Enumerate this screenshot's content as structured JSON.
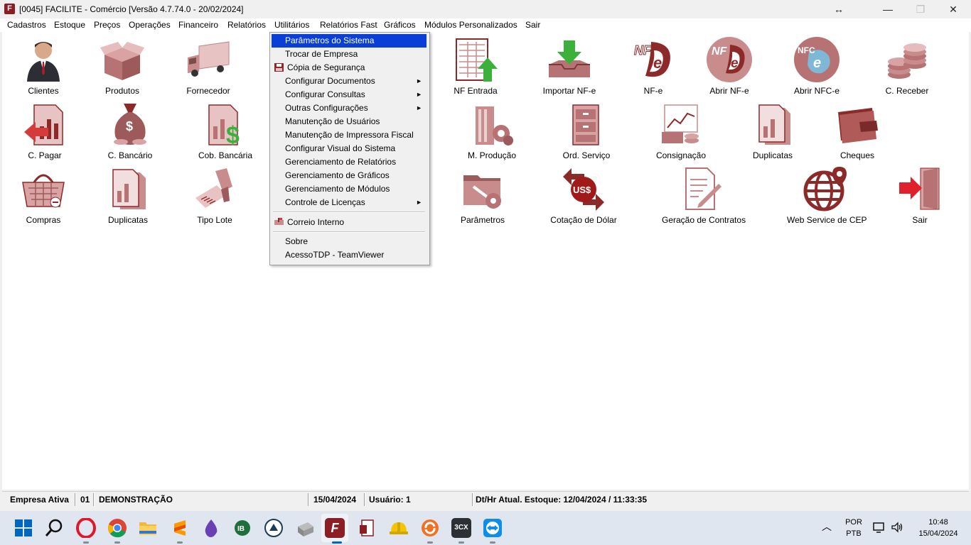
{
  "window": {
    "title": "[0045] FACILITE - Comércio [Versão 4.7.74.0 - 20/02/2024]",
    "app_icon_letter": "F",
    "resize_glyph": "↔",
    "minimize_glyph": "—",
    "maximize_glyph": "❐",
    "close_glyph": "✕"
  },
  "menu": {
    "items": [
      "Cadastros",
      "Estoque",
      "Preços",
      "Operações",
      "Financeiro",
      "Relatórios",
      "Utilitários",
      "Relatórios Fast",
      "Gráficos",
      "Módulos Personalizados",
      "Sair"
    ],
    "active": "Utilitários"
  },
  "dropdown": {
    "items": [
      {
        "label": "Parâmetros do Sistema",
        "selected": true
      },
      {
        "label": "Trocar de Empresa"
      },
      {
        "label": "Cópia de Segurança",
        "icon": "floppy-disk-icon"
      },
      {
        "label": "Configurar Documentos",
        "submenu": true
      },
      {
        "label": "Configurar Consultas",
        "submenu": true
      },
      {
        "label": "Outras Configurações",
        "submenu": true
      },
      {
        "label": "Manutenção de Usuários"
      },
      {
        "label": "Manutenção de Impressora Fiscal"
      },
      {
        "label": "Configurar Visual do Sistema"
      },
      {
        "label": "Gerenciamento de Relatórios"
      },
      {
        "label": "Gerenciamento de Gráficos"
      },
      {
        "label": "Gerenciamento de Módulos"
      },
      {
        "label": "Controle de Licenças",
        "submenu": true
      },
      {
        "label": "Correio Interno",
        "icon": "mailbox-icon"
      },
      {
        "label": "Sobre"
      },
      {
        "label": "AcessoTDP - TeamViewer"
      }
    ],
    "submenu_arrow": "►"
  },
  "shortcuts": {
    "row1": [
      "Clientes",
      "Produtos",
      "Fornecedor",
      "NF Entrada",
      "Importar NF-e",
      "NF-e",
      "Abrir NF-e",
      "Abrir NFC-e",
      "C. Receber"
    ],
    "row2": [
      "C. Pagar",
      "C. Bancário",
      "Cob. Bancária",
      "M. Produção",
      "Ord. Serviço",
      "Consignação",
      "Duplicatas",
      "Cheques"
    ],
    "row3": [
      "Compras",
      "Duplicatas",
      "Tipo Lote",
      "Parâmetros",
      "Cotação de Dólar",
      "Geração de Contratos",
      "Web Service de CEP",
      "Sair"
    ],
    "icon_text": {
      "nfe": "NF",
      "nfce": "NFC",
      "usd": "US$",
      "dollar": "$"
    }
  },
  "status": {
    "empresa_label": "Empresa Ativa",
    "empresa_code": "01",
    "empresa_name": "DEMONSTRAÇÃO",
    "date": "15/04/2024",
    "usuario": "Usuário: 1",
    "estoque": "Dt/Hr Atual. Estoque: 12/04/2024 / 11:33:35"
  },
  "taskbar": {
    "lang_top": "POR",
    "lang_bottom": "PTB",
    "time": "10:48",
    "date": "15/04/2024",
    "chevron": "︿",
    "ib_text": "IB",
    "threecx_text": "3CX",
    "app_letter": "F"
  },
  "colors": {
    "accent": "#0a3fd7",
    "icon_main": "#c98c8c",
    "icon_dark": "#8c2a2a",
    "icon_red": "#d63b3b",
    "icon_green": "#3bb13b"
  }
}
